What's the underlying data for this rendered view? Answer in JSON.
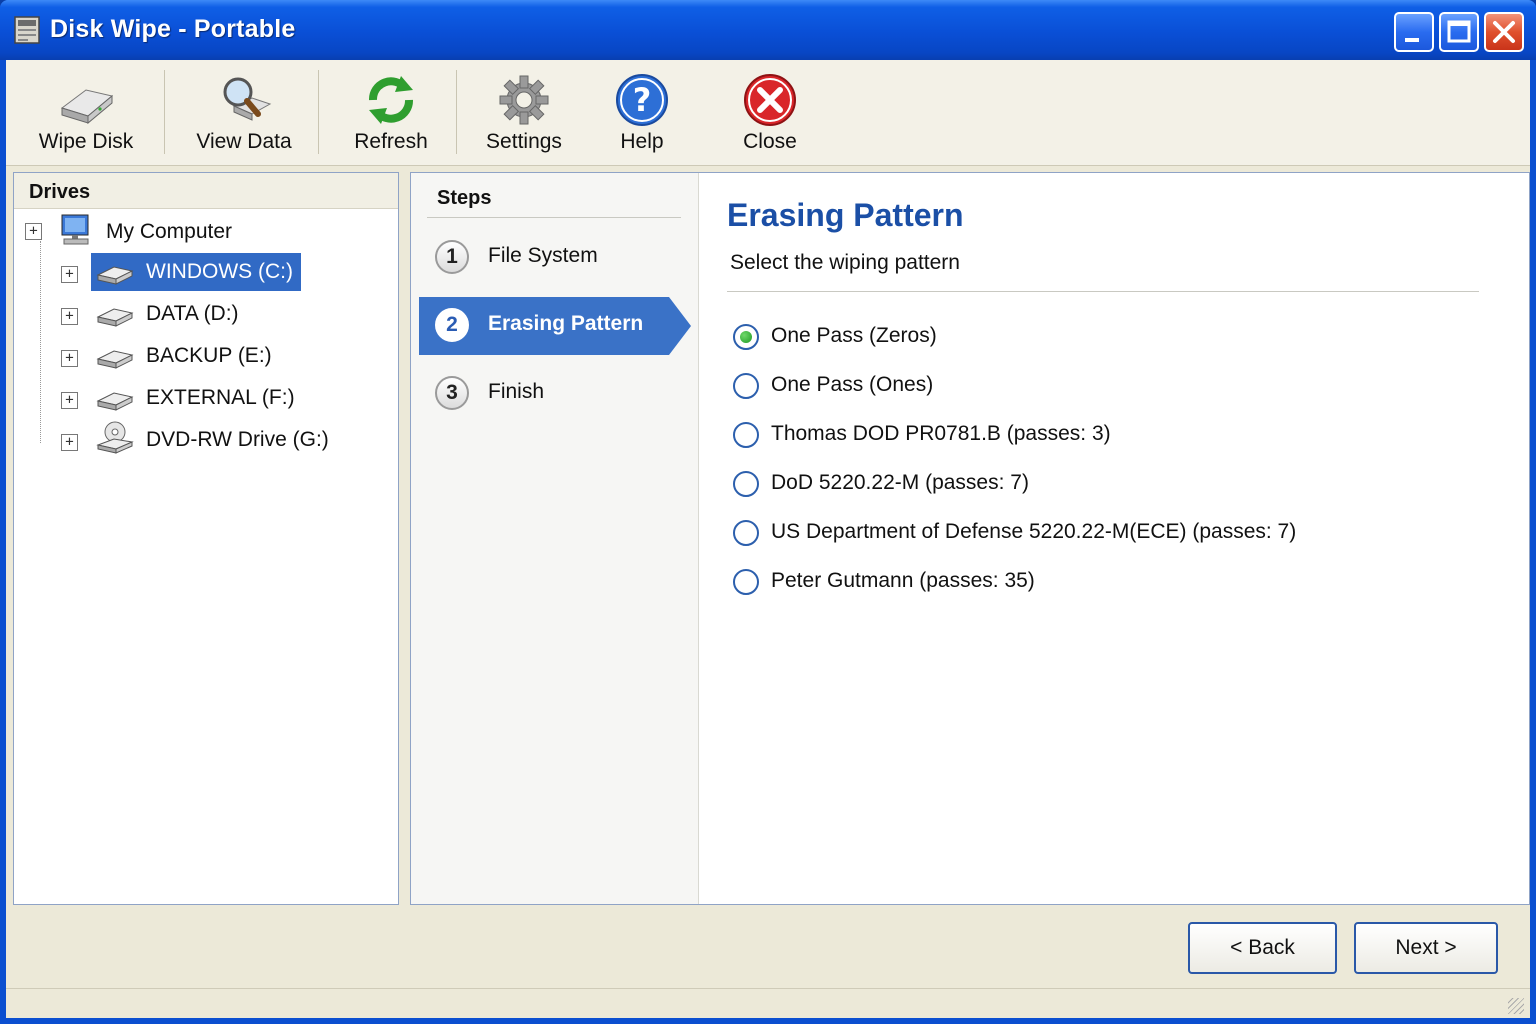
{
  "window": {
    "title": "Disk Wipe - Portable",
    "controls": [
      "minimize",
      "maximize",
      "close"
    ]
  },
  "toolbar": {
    "items": [
      {
        "label": "Wipe Disk",
        "icon": "drive-icon"
      },
      {
        "label": "View Data",
        "icon": "magnifier-icon"
      },
      {
        "label": "Refresh",
        "icon": "refresh-icon"
      },
      {
        "label": "Settings",
        "icon": "gear-icon"
      },
      {
        "label": "Help",
        "icon": "help-icon"
      },
      {
        "label": "Close",
        "icon": "close-icon"
      }
    ]
  },
  "drives": {
    "header": "Drives",
    "root": "My Computer",
    "items": [
      {
        "label": "WINDOWS (C:)",
        "selected": true
      },
      {
        "label": "DATA (D:)"
      },
      {
        "label": "BACKUP (E:)"
      },
      {
        "label": "EXTERNAL (F:)"
      },
      {
        "label": "DVD-RW Drive (G:)"
      }
    ]
  },
  "steps": {
    "header": "Steps",
    "items": [
      {
        "num": "1",
        "label": "File System"
      },
      {
        "num": "2",
        "label": "Erasing Pattern",
        "active": true
      },
      {
        "num": "3",
        "label": "Finish"
      }
    ]
  },
  "content": {
    "title": "Erasing Pattern",
    "subtitle": "Select the wiping pattern",
    "options": [
      {
        "label": "One Pass (Zeros)",
        "checked": true
      },
      {
        "label": "One Pass (Ones)"
      },
      {
        "label": "Thomas DOD PR0781.B (passes: 3)"
      },
      {
        "label": "DoD 5220.22-M (passes: 7)"
      },
      {
        "label": "US Department of Defense 5220.22-M(ECE) (passes: 7)"
      },
      {
        "label": "Peter Gutmann (passes: 35)"
      }
    ]
  },
  "buttons": {
    "back": "< Back",
    "next": "Next >"
  },
  "colors": {
    "titlebar": "#0a4fd6",
    "selection": "#316ac5",
    "heading": "#1b4fa6",
    "radio_checked": "#1e9a24"
  }
}
